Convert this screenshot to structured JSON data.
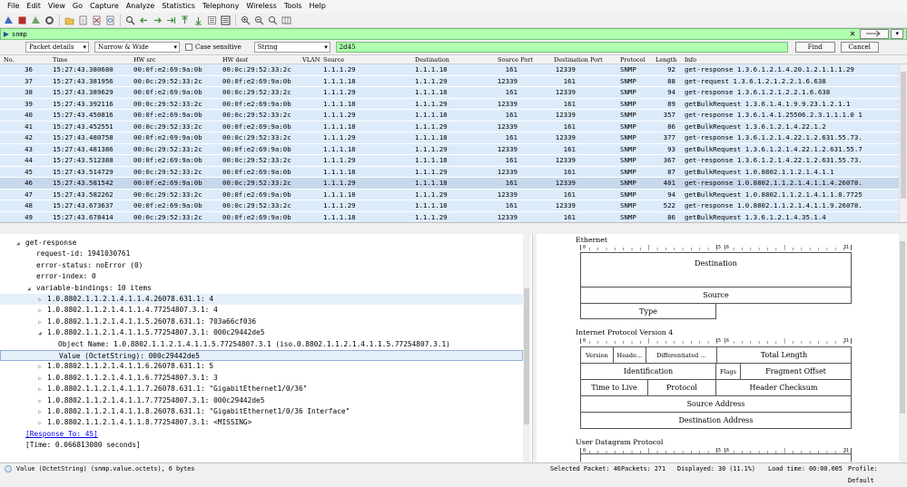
{
  "menu": [
    "File",
    "Edit",
    "View",
    "Go",
    "Capture",
    "Analyze",
    "Statistics",
    "Telephony",
    "Wireless",
    "Tools",
    "Help"
  ],
  "toolbar_icons": [
    "shark-fin-start-icon",
    "stop-icon",
    "restart-icon",
    "options-gear-icon",
    "open-file-icon",
    "save-icon",
    "close-file-icon",
    "reload-icon",
    "find-icon",
    "back-arrow-icon",
    "forward-arrow-icon",
    "goto-icon",
    "first-packet-icon",
    "last-packet-icon",
    "autoscroll-icon",
    "colorize-icon",
    "zoom-in-icon",
    "zoom-out-icon",
    "zoom-normal-icon",
    "resize-columns-icon"
  ],
  "filter": {
    "value": "snmp",
    "arrow_label": "▾",
    "bookmark_glyph": "▶"
  },
  "find": {
    "scope": "Packet details",
    "charwidth": "Narrow & Wide",
    "case_sensitive_label": "Case sensitive",
    "type": "String",
    "query": "2d45",
    "find_label": "Find",
    "cancel_label": "Cancel"
  },
  "columns": [
    "No.",
    "Time",
    "HW src",
    "HW dest",
    "VLAN",
    "Source",
    "Destination",
    "Source Port",
    "Destination Port",
    "Protocol",
    "Length",
    "Info"
  ],
  "packets": [
    {
      "no": "36",
      "time": "15:27:43.380680",
      "hwsrc": "00:0f:e2:69:9a:0b",
      "hwdst": "00:0c:29:52:33:2c",
      "src": "1.1.1.29",
      "dst": "1.1.1.18",
      "sport": "161",
      "dport": "12339",
      "proto": "SNMP",
      "len": "92",
      "info": "get-response 1.3.6.1.2.1.4.20.1.2.1.1.1.29"
    },
    {
      "no": "37",
      "time": "15:27:43.381956",
      "hwsrc": "00:0c:29:52:33:2c",
      "hwdst": "00:0f:e2:69:9a:0b",
      "src": "1.1.1.18",
      "dst": "1.1.1.29",
      "sport": "12339",
      "dport": "161",
      "proto": "SNMP",
      "len": "88",
      "info": "get-request 1.3.6.1.2.1.2.2.1.6.638"
    },
    {
      "no": "38",
      "time": "15:27:43.389629",
      "hwsrc": "00:0f:e2:69:9a:0b",
      "hwdst": "00:0c:29:52:33:2c",
      "src": "1.1.1.29",
      "dst": "1.1.1.18",
      "sport": "161",
      "dport": "12339",
      "proto": "SNMP",
      "len": "94",
      "info": "get-response 1.3.6.1.2.1.2.2.1.6.638"
    },
    {
      "no": "39",
      "time": "15:27:43.392116",
      "hwsrc": "00:0c:29:52:33:2c",
      "hwdst": "00:0f:e2:69:9a:0b",
      "src": "1.1.1.18",
      "dst": "1.1.1.29",
      "sport": "12339",
      "dport": "161",
      "proto": "SNMP",
      "len": "89",
      "info": "getBulkRequest 1.3.6.1.4.1.9.9.23.1.2.1.1"
    },
    {
      "no": "40",
      "time": "15:27:43.450816",
      "hwsrc": "00:0f:e2:69:9a:0b",
      "hwdst": "00:0c:29:52:33:2c",
      "src": "1.1.1.29",
      "dst": "1.1.1.18",
      "sport": "161",
      "dport": "12339",
      "proto": "SNMP",
      "len": "357",
      "info": "get-response 1.3.6.1.4.1.25506.2.3.1.1.1.0 1"
    },
    {
      "no": "41",
      "time": "15:27:43.452551",
      "hwsrc": "00:0c:29:52:33:2c",
      "hwdst": "00:0f:e2:69:9a:0b",
      "src": "1.1.1.18",
      "dst": "1.1.1.29",
      "sport": "12339",
      "dport": "161",
      "proto": "SNMP",
      "len": "86",
      "info": "getBulkRequest 1.3.6.1.2.1.4.22.1.2"
    },
    {
      "no": "42",
      "time": "15:27:43.480758",
      "hwsrc": "00:0f:e2:69:9a:0b",
      "hwdst": "00:0c:29:52:33:2c",
      "src": "1.1.1.29",
      "dst": "1.1.1.18",
      "sport": "161",
      "dport": "12339",
      "proto": "SNMP",
      "len": "377",
      "info": "get-response 1.3.6.1.2.1.4.22.1.2.631.55.73."
    },
    {
      "no": "43",
      "time": "15:27:43.481386",
      "hwsrc": "00:0c:29:52:33:2c",
      "hwdst": "00:0f:e2:69:9a:0b",
      "src": "1.1.1.18",
      "dst": "1.1.1.29",
      "sport": "12339",
      "dport": "161",
      "proto": "SNMP",
      "len": "93",
      "info": "getBulkRequest 1.3.6.1.2.1.4.22.1.2.631.55.7"
    },
    {
      "no": "44",
      "time": "15:27:43.512388",
      "hwsrc": "00:0f:e2:69:9a:0b",
      "hwdst": "00:0c:29:52:33:2c",
      "src": "1.1.1.29",
      "dst": "1.1.1.18",
      "sport": "161",
      "dport": "12339",
      "proto": "SNMP",
      "len": "367",
      "info": "get-response 1.3.6.1.2.1.4.22.1.2.631.55.73."
    },
    {
      "no": "45",
      "time": "15:27:43.514729",
      "hwsrc": "00:0c:29:52:33:2c",
      "hwdst": "00:0f:e2:69:9a:0b",
      "src": "1.1.1.18",
      "dst": "1.1.1.29",
      "sport": "12339",
      "dport": "161",
      "proto": "SNMP",
      "len": "87",
      "info": "getBulkRequest 1.0.8802.1.1.2.1.4.1.1"
    },
    {
      "no": "46",
      "time": "15:27:43.581542",
      "hwsrc": "00:0f:e2:69:9a:0b",
      "hwdst": "00:0c:29:52:33:2c",
      "src": "1.1.1.29",
      "dst": "1.1.1.18",
      "sport": "161",
      "dport": "12339",
      "proto": "SNMP",
      "len": "401",
      "info": "get-response 1.0.8802.1.1.2.1.4.1.1.4.26078."
    },
    {
      "no": "47",
      "time": "15:27:43.582262",
      "hwsrc": "00:0c:29:52:33:2c",
      "hwdst": "00:0f:e2:69:9a:0b",
      "src": "1.1.1.18",
      "dst": "1.1.1.29",
      "sport": "12339",
      "dport": "161",
      "proto": "SNMP",
      "len": "94",
      "info": "getBulkRequest 1.0.8802.1.1.2.1.4.1.1.8.7725"
    },
    {
      "no": "48",
      "time": "15:27:43.673637",
      "hwsrc": "00:0f:e2:69:9a:0b",
      "hwdst": "00:0c:29:52:33:2c",
      "src": "1.1.1.29",
      "dst": "1.1.1.18",
      "sport": "161",
      "dport": "12339",
      "proto": "SNMP",
      "len": "522",
      "info": "get-response 1.0.8802.1.1.2.1.4.1.1.9.26078."
    },
    {
      "no": "49",
      "time": "15:27:43.678414",
      "hwsrc": "00:0c:29:52:33:2c",
      "hwdst": "00:0f:e2:69:9a:0b",
      "src": "1.1.1.18",
      "dst": "1.1.1.29",
      "sport": "12339",
      "dport": "161",
      "proto": "SNMP",
      "len": "86",
      "info": "getBulkRequest 1.3.6.1.2.1.4.35.1.4"
    }
  ],
  "details": [
    {
      "arrow": "◢",
      "text": "get-response",
      "indent": 0
    },
    {
      "arrow": "",
      "text": "request-id: 1941030761",
      "indent": 1
    },
    {
      "arrow": "",
      "text": "error-status: noError (0)",
      "indent": 1
    },
    {
      "arrow": "",
      "text": "error-index: 0",
      "indent": 1
    },
    {
      "arrow": "◢",
      "text": "variable-bindings: 10 items",
      "indent": 1
    },
    {
      "arrow": "▷",
      "text": "1.0.8802.1.1.2.1.4.1.1.4.26078.631.1: 4",
      "indent": 2
    },
    {
      "arrow": "▷",
      "text": "1.0.8802.1.1.2.1.4.1.1.4.77254807.3.1: 4",
      "indent": 2
    },
    {
      "arrow": "▷",
      "text": "1.0.8802.1.1.2.1.4.1.1.5.26078.631.1: 703a66cf036",
      "indent": 2
    },
    {
      "arrow": "◢",
      "text": "1.0.8802.1.1.2.1.4.1.1.5.77254807.3.1: 000c29442de5",
      "indent": 2
    },
    {
      "arrow": "",
      "text": "Object Name: 1.0.8802.1.1.2.1.4.1.1.5.77254807.3.1 (iso.0.8802.1.1.2.1.4.1.1.5.77254807.3.1)",
      "indent": 3
    },
    {
      "arrow": "",
      "text": "Value (OctetString): 000c29442de5",
      "indent": 3
    },
    {
      "arrow": "▷",
      "text": "1.0.8802.1.1.2.1.4.1.1.6.26078.631.1: 5",
      "indent": 2
    },
    {
      "arrow": "▷",
      "text": "1.0.8802.1.1.2.1.4.1.1.6.77254807.3.1: 3",
      "indent": 2
    },
    {
      "arrow": "▷",
      "text": "1.0.8802.1.1.2.1.4.1.1.7.26078.631.1: \"GigabitEthernet1/0/36\"",
      "indent": 2
    },
    {
      "arrow": "▷",
      "text": "1.0.8802.1.1.2.1.4.1.1.7.77254807.3.1: 000c29442de5",
      "indent": 2
    },
    {
      "arrow": "▷",
      "text": "1.0.8802.1.1.2.1.4.1.1.8.26078.631.1: \"GigabitEthernet1/0/36 Interface\"",
      "indent": 2
    },
    {
      "arrow": "▷",
      "text": "1.0.8802.1.1.2.1.4.1.1.8.77254807.3.1: <MISSING>",
      "indent": 2
    },
    {
      "arrow": "",
      "text": "[Response To: 45]",
      "indent": 0,
      "link": true
    },
    {
      "arrow": "",
      "text": "[Time: 0.066813000 seconds]",
      "indent": 0
    }
  ],
  "diagram": {
    "eth_title": "Ethernet",
    "eth_dst": "Destination",
    "eth_src": "Source",
    "eth_type": "Type",
    "ip_title": "Internet Protocol Version 4",
    "ip_version": "Version",
    "ip_header": "Heade…",
    "ip_dsf": "Differentiated …",
    "ip_total": "Total Length",
    "ip_id": "Identification",
    "ip_flags": "Flags",
    "ip_frag": "Fragment Offset",
    "ip_ttl": "Time to Live",
    "ip_proto": "Protocol",
    "ip_csum": "Header Checksum",
    "ip_src": "Source Address",
    "ip_dst": "Destination Address",
    "udp_title": "User Datagram Protocol",
    "r0": "0",
    "r1": "1",
    "r15": "15",
    "r16": "16",
    "r31": "31",
    "r3": "3"
  },
  "status": {
    "field": "Value (OctetString) (snmp.value.octets), 6 bytes",
    "selected": "Selected Packet: 46",
    "packets": "Packets: 271",
    "displayed": "Displayed: 30 (11.1%)",
    "load": "Load time: 00:00.005",
    "profile": "Profile: Default"
  },
  "colors": {
    "row_bg": "#dcebfa",
    "filter_ok": "#afffaf",
    "selected_row": "#c7d8ec"
  }
}
